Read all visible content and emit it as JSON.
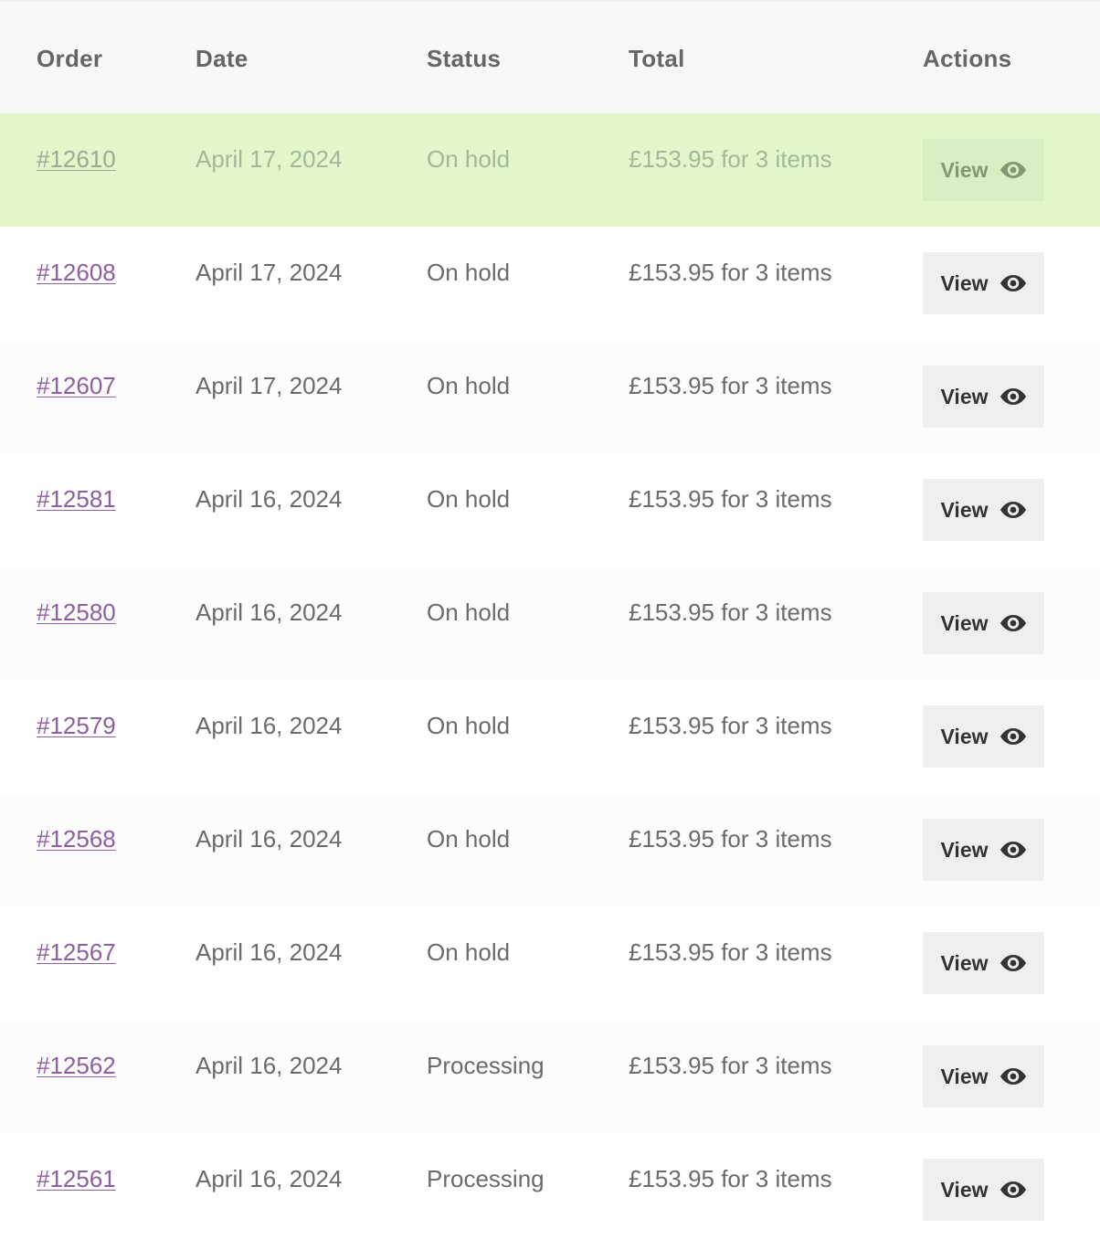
{
  "table": {
    "headers": {
      "order": "Order",
      "date": "Date",
      "status": "Status",
      "total": "Total",
      "actions": "Actions"
    },
    "rows": [
      {
        "order": "#12610",
        "date": "April 17, 2024",
        "status": "On hold",
        "total": "£153.95 for 3 items",
        "action_label": "View",
        "highlighted": true
      },
      {
        "order": "#12608",
        "date": "April 17, 2024",
        "status": "On hold",
        "total": "£153.95 for 3 items",
        "action_label": "View"
      },
      {
        "order": "#12607",
        "date": "April 17, 2024",
        "status": "On hold",
        "total": "£153.95 for 3 items",
        "action_label": "View"
      },
      {
        "order": "#12581",
        "date": "April 16, 2024",
        "status": "On hold",
        "total": "£153.95 for 3 items",
        "action_label": "View"
      },
      {
        "order": "#12580",
        "date": "April 16, 2024",
        "status": "On hold",
        "total": "£153.95 for 3 items",
        "action_label": "View"
      },
      {
        "order": "#12579",
        "date": "April 16, 2024",
        "status": "On hold",
        "total": "£153.95 for 3 items",
        "action_label": "View"
      },
      {
        "order": "#12568",
        "date": "April 16, 2024",
        "status": "On hold",
        "total": "£153.95 for 3 items",
        "action_label": "View"
      },
      {
        "order": "#12567",
        "date": "April 16, 2024",
        "status": "On hold",
        "total": "£153.95 for 3 items",
        "action_label": "View"
      },
      {
        "order": "#12562",
        "date": "April 16, 2024",
        "status": "Processing",
        "total": "£153.95 for 3 items",
        "action_label": "View"
      },
      {
        "order": "#12561",
        "date": "April 16, 2024",
        "status": "Processing",
        "total": "£153.95 for 3 items",
        "action_label": "View"
      }
    ],
    "action_icon": "eye-icon"
  },
  "colors": {
    "highlight_row": "#e2f8cb",
    "order_link": "#8e5ea2",
    "button_bg": "#efefef"
  }
}
